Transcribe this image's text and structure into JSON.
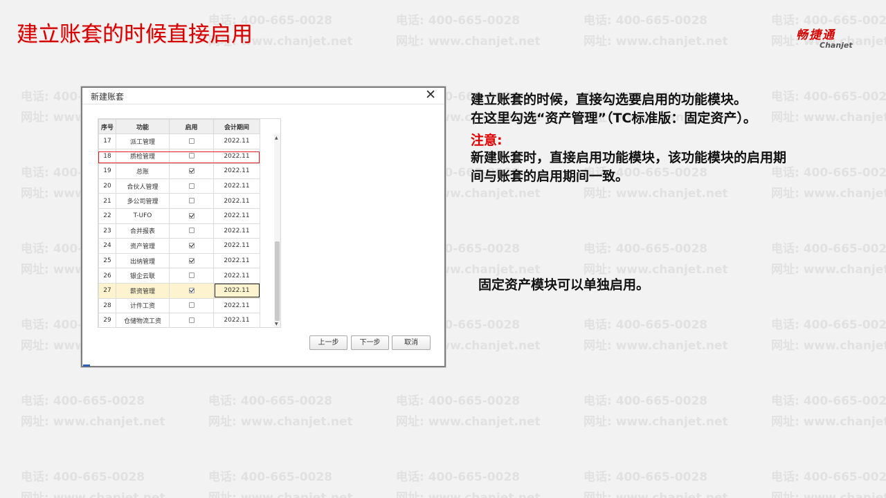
{
  "slide": {
    "title": "建立账套的时候直接启用",
    "logo_main": "畅捷通",
    "logo_sub": "Chanjet"
  },
  "watermark": {
    "phone": "电话: 400-665-0028",
    "site": "网址: www.chanjet.net"
  },
  "dialog": {
    "title": "新建账套",
    "close_glyph": "✕",
    "columns": [
      "序号",
      "功能",
      "启用",
      "会计期间"
    ],
    "rows": [
      {
        "seq": "17",
        "func": "派工管理",
        "enabled": false,
        "period": "2022.11"
      },
      {
        "seq": "18",
        "func": "质检管理",
        "enabled": false,
        "period": "2022.11"
      },
      {
        "seq": "19",
        "func": "总账",
        "enabled": true,
        "period": "2022.11"
      },
      {
        "seq": "20",
        "func": "合伙人管理",
        "enabled": false,
        "period": "2022.11"
      },
      {
        "seq": "21",
        "func": "多公司管理",
        "enabled": false,
        "period": "2022.11"
      },
      {
        "seq": "22",
        "func": "T-UFO",
        "enabled": true,
        "period": "2022.11"
      },
      {
        "seq": "23",
        "func": "合并报表",
        "enabled": false,
        "period": "2022.11"
      },
      {
        "seq": "24",
        "func": "资产管理",
        "enabled": true,
        "period": "2022.11"
      },
      {
        "seq": "25",
        "func": "出纳管理",
        "enabled": true,
        "period": "2022.11"
      },
      {
        "seq": "26",
        "func": "银企云联",
        "enabled": false,
        "period": "2022.11"
      },
      {
        "seq": "27",
        "func": "薪资管理",
        "enabled": true,
        "period": "2022.11"
      },
      {
        "seq": "28",
        "func": "计件工资",
        "enabled": false,
        "period": "2022.11"
      },
      {
        "seq": "29",
        "func": "仓储物流工资",
        "enabled": false,
        "period": "2022.11"
      }
    ],
    "highlighted_row_seq": "27",
    "outlined_row_seq": "24",
    "buttons": {
      "prev": "上一步",
      "next": "下一步",
      "cancel": "取消"
    }
  },
  "description": {
    "line1": "建立账套的时候，直接勾选要启用的功能模块。",
    "line2": "在这里勾选“资产管理”（TC标准版：固定资产）。",
    "note_label": "注意:",
    "note_text": "新建账套时，直接启用功能模块，该功能模块的启用期间与账套的启用期间一致。",
    "extra": "固定资产模块可以单独启用。"
  },
  "colors": {
    "title_red": "#d40000",
    "outline_red": "#e02020",
    "row_highlight": "#fdf3cf",
    "watermark": "#e1e1e1"
  }
}
